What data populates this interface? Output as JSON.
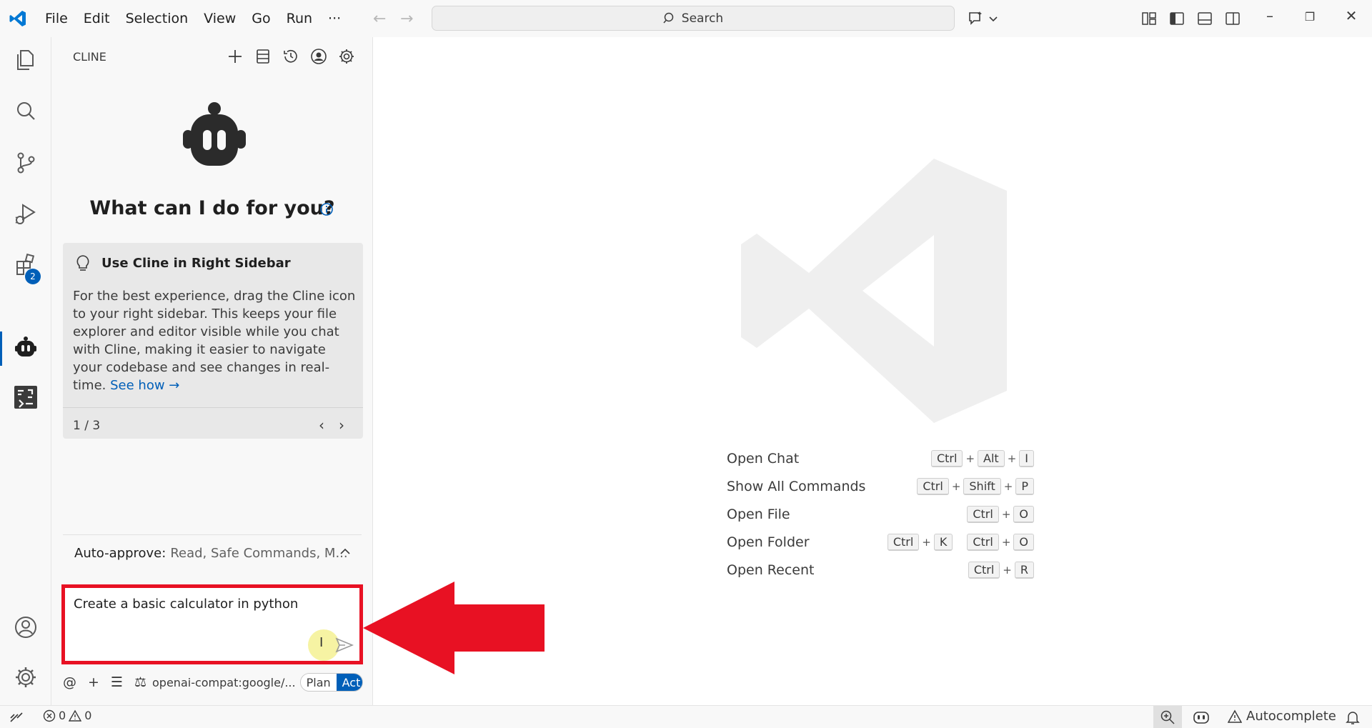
{
  "titlebar": {
    "menu": [
      "File",
      "Edit",
      "Selection",
      "View",
      "Go",
      "Run",
      "···"
    ],
    "search_placeholder": "Search"
  },
  "activitybar": {
    "extensions_badge": "2"
  },
  "sidebar": {
    "title": "CLINE",
    "headline": "What can I do for you?",
    "tip": {
      "heading": "Use Cline in Right Sidebar",
      "body": "For the best experience, drag the Cline icon to your right sidebar. This keeps your file explorer and editor visible while you chat with Cline, making it easier to navigate your codebase and see changes in real-time.",
      "link": "See how →",
      "page": "1 / 3"
    },
    "auto_approve": {
      "label": "Auto-approve:",
      "values": "Read, Safe Commands, M..."
    },
    "input": {
      "value": "Create a basic calculator in python"
    },
    "footer": {
      "model": "openai-compat:google/...",
      "mode_plan": "Plan",
      "mode_act": "Act"
    }
  },
  "editor": {
    "shortcuts": [
      {
        "label": "Open Chat",
        "keys": [
          [
            "Ctrl",
            "Alt",
            "I"
          ]
        ]
      },
      {
        "label": "Show All Commands",
        "keys": [
          [
            "Ctrl",
            "Shift",
            "P"
          ]
        ]
      },
      {
        "label": "Open File",
        "keys": [
          [
            "Ctrl",
            "O"
          ]
        ]
      },
      {
        "label": "Open Folder",
        "keys": [
          [
            "Ctrl",
            "K"
          ],
          [
            "Ctrl",
            "O"
          ]
        ]
      },
      {
        "label": "Open Recent",
        "keys": [
          [
            "Ctrl",
            "R"
          ]
        ]
      }
    ]
  },
  "statusbar": {
    "errors": "0",
    "warnings": "0",
    "autocomplete": "Autocomplete"
  },
  "colors": {
    "accent": "#005fb8",
    "highlight_red": "#e81123"
  }
}
